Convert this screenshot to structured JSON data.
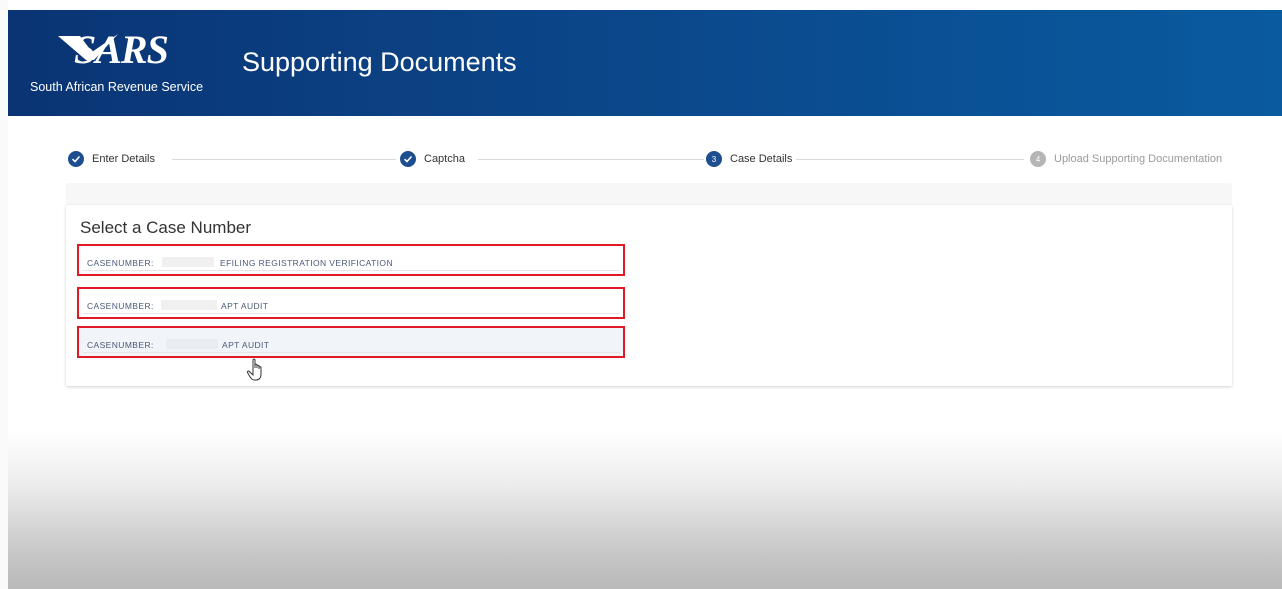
{
  "header": {
    "logo_text": "SARS",
    "logo_subtitle": "South African Revenue Service",
    "title": "Supporting Documents",
    "gradient_start": "#0a3474",
    "gradient_end": "#0a5aa0"
  },
  "stepper": {
    "steps": [
      {
        "label": "Enter Details",
        "state": "done",
        "icon": "check-icon"
      },
      {
        "label": "Captcha",
        "state": "done",
        "icon": "check-icon"
      },
      {
        "label": "Case Details",
        "state": "active",
        "number": "3"
      },
      {
        "label": "Upload Supporting Documentation",
        "state": "pending",
        "number": "4"
      }
    ]
  },
  "case_select": {
    "title": "Select a Case Number",
    "rows": [
      {
        "prefix": "CASENUMBER:",
        "case_number": "",
        "description": "EFILING REGISTRATION VERIFICATION"
      },
      {
        "prefix": "CASENUMBER:",
        "case_number": "",
        "description": "APT AUDIT"
      },
      {
        "prefix": "CASENUMBER:",
        "case_number": "",
        "description": "APT AUDIT"
      }
    ],
    "highlight_color": "#e01a22"
  },
  "accent_color": "#1d4e8f"
}
